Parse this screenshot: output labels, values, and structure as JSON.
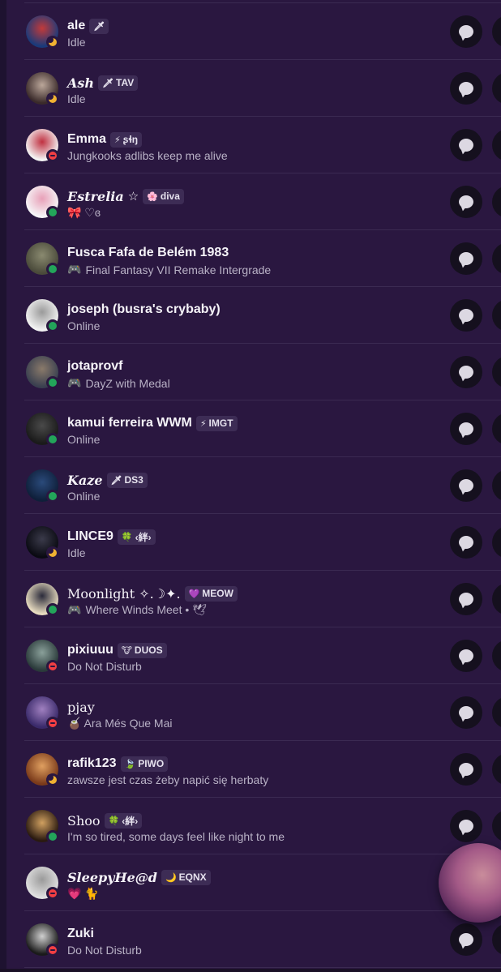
{
  "members": [
    {
      "name": "ale",
      "tag": {
        "icon": "sword-icon",
        "glyph": "🗡",
        "label": ""
      },
      "subtitle": "Idle",
      "status": "idle",
      "avatar": [
        "#1a3a7a",
        "#c23a3a"
      ]
    },
    {
      "name": "Ash",
      "name_style": "script",
      "tag": {
        "icon": "sword-icon",
        "glyph": "🗡",
        "label": "TAV"
      },
      "subtitle": "Idle",
      "status": "idle",
      "avatar": [
        "#3a2a2a",
        "#bba79a"
      ]
    },
    {
      "name": "Emma",
      "tag": {
        "icon": "lightning-icon",
        "glyph": "⚡",
        "label": "ʂɬŋ"
      },
      "subtitle": "Jungkooks adlibs keep me alive",
      "status": "dnd",
      "avatar": [
        "#f4f4f4",
        "#c03040"
      ]
    },
    {
      "name": "Estrelia",
      "name_style": "script",
      "name_suffix": "☆",
      "tag": {
        "icon": "flower-icon",
        "glyph": "🌸",
        "label": "diva"
      },
      "subtitle": "🎀 ♡ɞ",
      "status": "online",
      "avatar": [
        "#f6f6f8",
        "#e8a0b8"
      ]
    },
    {
      "name": "Fusca Fafa de Belém 1983",
      "subtitle": "Final Fantasy VII Remake Intergrade",
      "subtitle_icon": "gamepad-icon",
      "status": "online",
      "avatar": [
        "#4a4a3a",
        "#8a8a70"
      ]
    },
    {
      "name": "joseph (busra's crybaby)",
      "subtitle": "Online",
      "status": "online",
      "avatar": [
        "#f2f2f2",
        "#9a9a9a"
      ]
    },
    {
      "name": "jotaprovf",
      "subtitle": "DayZ with Medal",
      "subtitle_icon": "gamepad-icon",
      "status": "online",
      "avatar": [
        "#3a4050",
        "#8a7a6a"
      ]
    },
    {
      "name": "kamui ferreira WWM",
      "tag": {
        "icon": "lightning-icon",
        "glyph": "⚡",
        "label": "IMGT"
      },
      "subtitle": "Online",
      "status": "online",
      "avatar": [
        "#1a1a1a",
        "#4a4a4a"
      ]
    },
    {
      "name": "Kaze",
      "name_style": "script",
      "tag": {
        "icon": "sword-icon",
        "glyph": "🗡",
        "label": "DS3"
      },
      "subtitle": "Online",
      "status": "online",
      "avatar": [
        "#0f1f3a",
        "#2a4a7a"
      ]
    },
    {
      "name": "LINCE9",
      "tag": {
        "icon": "leaf-icon",
        "glyph": "🍀",
        "label": "‹絆›"
      },
      "subtitle": "Idle",
      "status": "idle",
      "avatar": [
        "#0a0a12",
        "#3a3a4a"
      ]
    },
    {
      "name": "Moonlight ✧.☽✦.",
      "name_style": "serif",
      "tag": {
        "icon": "heart-icon",
        "glyph": "💜",
        "label": "MEOW"
      },
      "subtitle": "Where Winds Meet • 🕊",
      "subtitle_icon": "gamepad-icon",
      "status": "online",
      "avatar": [
        "#e8dcc0",
        "#2a2a3a"
      ]
    },
    {
      "name": "pixiuuu",
      "tag": {
        "icon": "ox-icon",
        "glyph": "🐮",
        "label": "DUOS"
      },
      "subtitle": "Do Not Disturb",
      "status": "dnd",
      "avatar": [
        "#2a3a3a",
        "#8aa09a"
      ]
    },
    {
      "name": "pjay",
      "name_style": "serif",
      "subtitle": "🧉 Ara Més Que Mai",
      "status": "dnd",
      "avatar": [
        "#3a2a6a",
        "#a080c0"
      ]
    },
    {
      "name": "rafik123",
      "tag": {
        "icon": "leaf-icon",
        "glyph": "🍃",
        "label": "PIWO"
      },
      "subtitle": "zawsze jest czas żeby napić się herbaty",
      "status": "idle",
      "avatar": [
        "#7a3a1a",
        "#e0a060"
      ]
    },
    {
      "name": "Shoo",
      "name_style": "serif",
      "tag": {
        "icon": "leaf-icon",
        "glyph": "🍀",
        "label": "‹絆›"
      },
      "subtitle": "I'm so tired, some days feel like night to me",
      "status": "online",
      "avatar": [
        "#2a1a10",
        "#d0a060"
      ]
    },
    {
      "name": "SleepyHe@d",
      "name_style": "script",
      "tag": {
        "icon": "moon-icon",
        "glyph": "🌙",
        "label": "EQNX"
      },
      "subtitle": "💗 🐈",
      "status": "dnd",
      "avatar": [
        "#e0e0e0",
        "#9a9a9a"
      ]
    },
    {
      "name": "Zuki",
      "subtitle": "Do Not Disturb",
      "status": "dnd",
      "avatar": [
        "#1a1a1a",
        "#d0d0d0"
      ]
    }
  ],
  "colors": {
    "online": "#23a55a",
    "idle": "#f0b232",
    "dnd": "#f23f43",
    "tag_bg": "#3d2c55",
    "panel_bg": "#2a1740"
  }
}
